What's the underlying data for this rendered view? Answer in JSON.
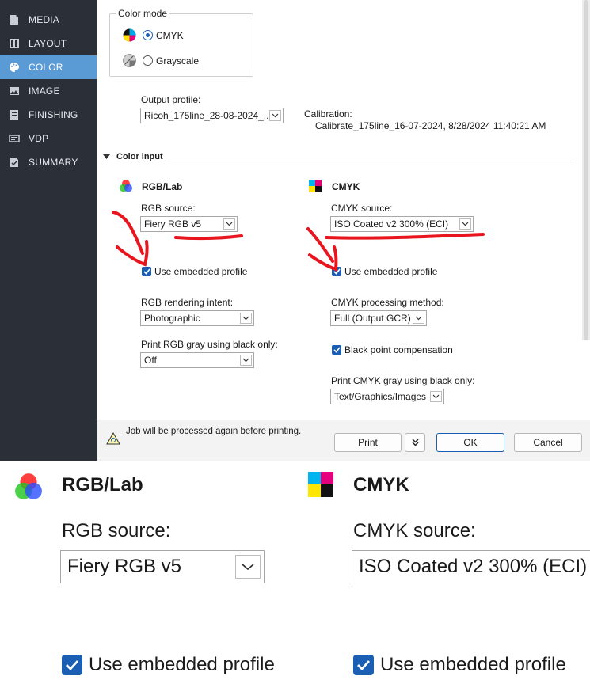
{
  "sidebar": {
    "items": [
      {
        "label": "MEDIA",
        "icon": "document-icon"
      },
      {
        "label": "LAYOUT",
        "icon": "layout-icon"
      },
      {
        "label": "COLOR",
        "icon": "palette-icon",
        "active": true
      },
      {
        "label": "IMAGE",
        "icon": "image-icon"
      },
      {
        "label": "FINISHING",
        "icon": "finishing-icon"
      },
      {
        "label": "VDP",
        "icon": "vdp-icon"
      },
      {
        "label": "SUMMARY",
        "icon": "summary-icon"
      }
    ]
  },
  "color_mode": {
    "legend": "Color mode",
    "options": [
      {
        "label": "CMYK",
        "selected": true
      },
      {
        "label": "Grayscale",
        "selected": false
      }
    ]
  },
  "output": {
    "label": "Output profile:",
    "value": "Ricoh_175line_28-08-2024_...",
    "calibration_label": "Calibration:",
    "calibration_value": "Calibrate_175line_16-07-2024, 8/28/2024 11:40:21 AM"
  },
  "color_input": {
    "title": "Color input",
    "rgb": {
      "heading": "RGB/Lab",
      "source_label": "RGB source:",
      "source_value": "Fiery RGB v5",
      "embedded_label": "Use embedded profile",
      "embedded_checked": true,
      "intent_label": "RGB rendering intent:",
      "intent_value": "Photographic",
      "gray_label": "Print RGB gray using black only:",
      "gray_value": "Off"
    },
    "cmyk": {
      "heading": "CMYK",
      "source_label": "CMYK source:",
      "source_value": "ISO Coated v2 300% (ECI)",
      "embedded_label": "Use embedded profile",
      "embedded_checked": true,
      "method_label": "CMYK processing method:",
      "method_value": "Full (Output GCR)",
      "bpc_label": "Black point compensation",
      "bpc_checked": true,
      "gray_label": "Print CMYK gray using black only:",
      "gray_value": "Text/Graphics/Images"
    }
  },
  "footer": {
    "warning": "Job will be processed again before printing.",
    "print_label": "Print",
    "ok_label": "OK",
    "cancel_label": "Cancel"
  },
  "colors": {
    "sidebar_bg": "#2b3038",
    "active_item": "#5b9bd5",
    "accent": "#1a5fb4",
    "annotation_red": "#e8141e"
  }
}
